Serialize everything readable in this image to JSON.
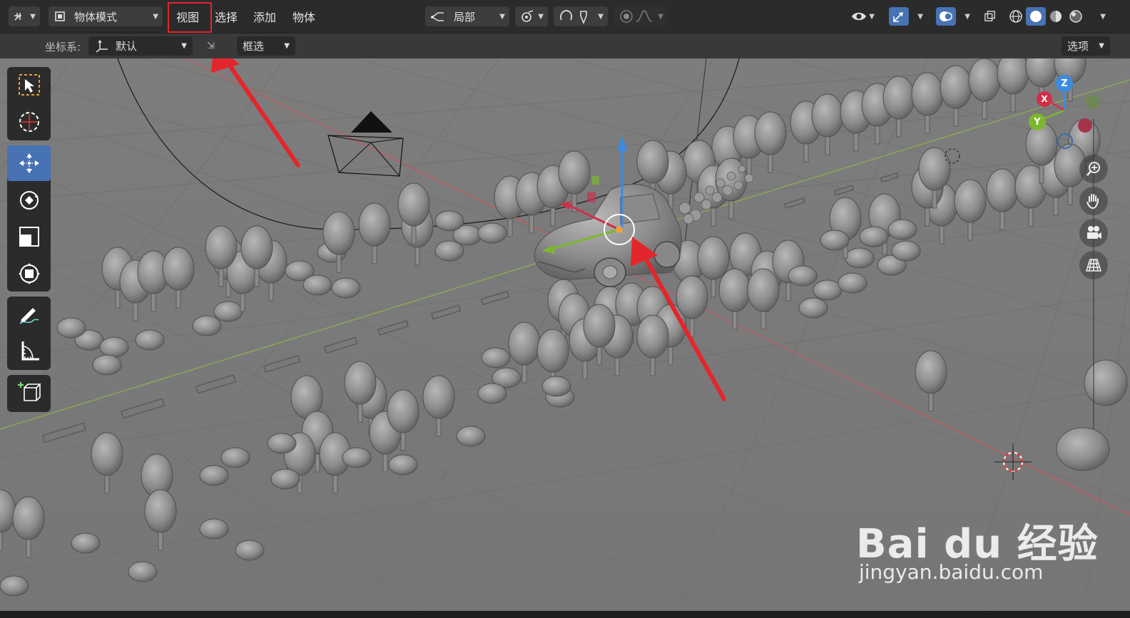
{
  "header": {
    "mode_label": "物体模式",
    "menus": [
      "视图",
      "选择",
      "添加",
      "物体"
    ],
    "pivot_label": "局部"
  },
  "tool_header": {
    "coord_label": "坐标系:",
    "coord_value": "默认",
    "select_mode": "框选",
    "options_label": "选项"
  },
  "gizmo": {
    "z": "Z",
    "x": "X",
    "y": "Y"
  },
  "watermark": {
    "logo_text": "Bai du 经验",
    "url": "jingyan.baidu.com"
  },
  "colors": {
    "accent": "#4772b3",
    "annotation": "#e3262b",
    "axis_x": "#d0304a",
    "axis_y": "#7cb82f",
    "axis_z": "#3d8be0"
  }
}
